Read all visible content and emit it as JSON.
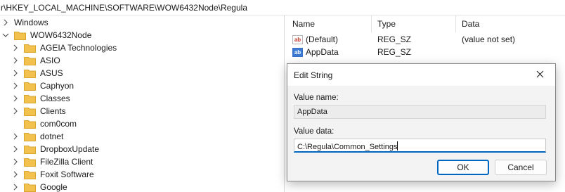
{
  "address_bar": {
    "path": "r\\HKEY_LOCAL_MACHINE\\SOFTWARE\\WOW6432Node\\Regula"
  },
  "tree": {
    "items": [
      {
        "label": "Windows",
        "expanded": false
      },
      {
        "label": "WOW6432Node",
        "expanded": true
      },
      {
        "label": "AGEIA Technologies"
      },
      {
        "label": "ASIO"
      },
      {
        "label": "ASUS"
      },
      {
        "label": "Caphyon"
      },
      {
        "label": "Classes"
      },
      {
        "label": "Clients"
      },
      {
        "label": "com0com"
      },
      {
        "label": "dotnet"
      },
      {
        "label": "DropboxUpdate"
      },
      {
        "label": "FileZilla Client"
      },
      {
        "label": "Foxit Software"
      },
      {
        "label": "Google"
      }
    ]
  },
  "values_list": {
    "columns": [
      "Name",
      "Type",
      "Data"
    ],
    "rows": [
      {
        "name": "(Default)",
        "type": "REG_SZ",
        "data": "(value not set)",
        "icon": "string-value-icon"
      },
      {
        "name": "AppData",
        "type": "REG_SZ",
        "data": "",
        "icon": "string-value-selected-icon"
      }
    ]
  },
  "dialog": {
    "title": "Edit String",
    "value_name_label": "Value name:",
    "value_name": "AppData",
    "value_data_label": "Value data:",
    "value_data": "C:\\Regula\\Common_Settings",
    "ok_label": "OK",
    "cancel_label": "Cancel"
  },
  "colors": {
    "accent": "#0067c0",
    "folder": "#f2c14e"
  }
}
